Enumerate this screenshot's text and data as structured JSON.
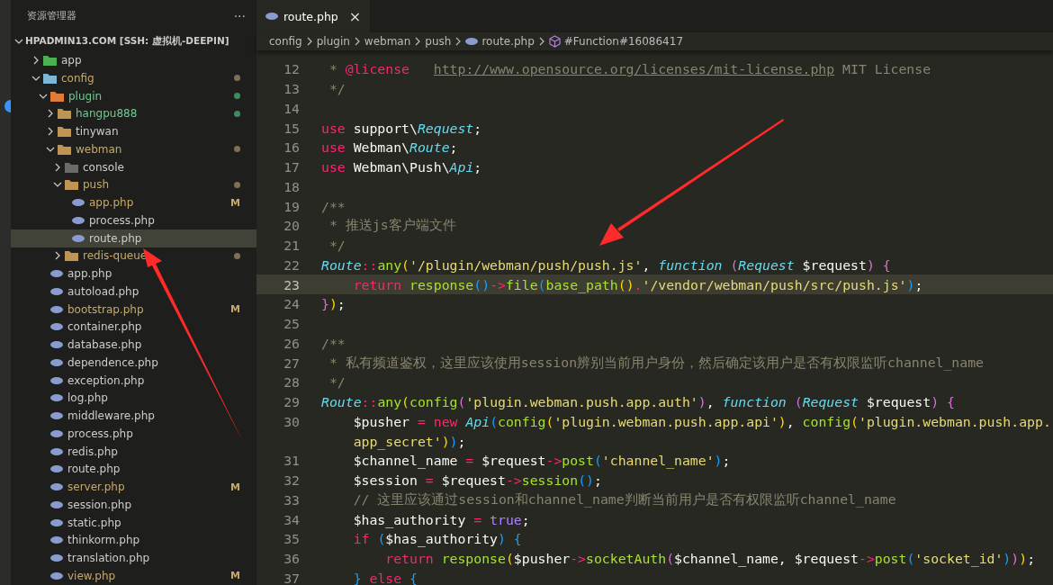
{
  "explorer": {
    "title": "资源管理器",
    "more": "···",
    "workspace": "HPADMIN13.COM [SSH: 虚拟机-DEEPIN]",
    "tree": [
      {
        "kind": "folder",
        "name": "app",
        "color": "#4caf50",
        "expanded": false,
        "modified": false,
        "untracked": false,
        "selected": false
      },
      {
        "kind": "folder",
        "name": "config",
        "color": "#7fb5d5",
        "expanded": true,
        "modified": true,
        "untracked": false,
        "selected": false,
        "children": [
          {
            "kind": "folder",
            "name": "plugin",
            "color": "#e07b39",
            "expanded": true,
            "modified": false,
            "untracked": true,
            "selected": false,
            "children": [
              {
                "kind": "folder",
                "name": "hangpu888",
                "color": "#c09553",
                "expanded": false,
                "modified": false,
                "untracked": true,
                "selected": false
              },
              {
                "kind": "folder",
                "name": "tinywan",
                "color": "#c09553",
                "expanded": false,
                "modified": false,
                "untracked": false,
                "selected": false
              },
              {
                "kind": "folder",
                "name": "webman",
                "color": "#c09553",
                "expanded": true,
                "modified": true,
                "untracked": false,
                "selected": false,
                "children": [
                  {
                    "kind": "folder",
                    "name": "console",
                    "color": "#6b6b6b",
                    "expanded": false,
                    "modified": false,
                    "untracked": false,
                    "selected": false
                  },
                  {
                    "kind": "folder",
                    "name": "push",
                    "color": "#c09553",
                    "expanded": true,
                    "modified": true,
                    "untracked": false,
                    "selected": false,
                    "children": [
                      {
                        "kind": "file",
                        "name": "app.php",
                        "modified": true,
                        "badge": "M",
                        "selected": false
                      },
                      {
                        "kind": "file",
                        "name": "process.php",
                        "modified": false,
                        "selected": false
                      },
                      {
                        "kind": "file",
                        "name": "route.php",
                        "modified": false,
                        "selected": true
                      }
                    ]
                  },
                  {
                    "kind": "folder",
                    "name": "redis-queue",
                    "color": "#c09553",
                    "expanded": false,
                    "modified": true,
                    "untracked": false,
                    "selected": false
                  }
                ]
              }
            ]
          },
          {
            "kind": "file",
            "name": "app.php",
            "modified": false,
            "selected": false
          },
          {
            "kind": "file",
            "name": "autoload.php",
            "modified": false,
            "selected": false
          },
          {
            "kind": "file",
            "name": "bootstrap.php",
            "modified": true,
            "badge": "M",
            "selected": false
          },
          {
            "kind": "file",
            "name": "container.php",
            "modified": false,
            "selected": false
          },
          {
            "kind": "file",
            "name": "database.php",
            "modified": false,
            "selected": false
          },
          {
            "kind": "file",
            "name": "dependence.php",
            "modified": false,
            "selected": false
          },
          {
            "kind": "file",
            "name": "exception.php",
            "modified": false,
            "selected": false
          },
          {
            "kind": "file",
            "name": "log.php",
            "modified": false,
            "selected": false
          },
          {
            "kind": "file",
            "name": "middleware.php",
            "modified": false,
            "selected": false
          },
          {
            "kind": "file",
            "name": "process.php",
            "modified": false,
            "selected": false
          },
          {
            "kind": "file",
            "name": "redis.php",
            "modified": false,
            "selected": false
          },
          {
            "kind": "file",
            "name": "route.php",
            "modified": false,
            "selected": false
          },
          {
            "kind": "file",
            "name": "server.php",
            "modified": true,
            "badge": "M",
            "selected": false
          },
          {
            "kind": "file",
            "name": "session.php",
            "modified": false,
            "selected": false
          },
          {
            "kind": "file",
            "name": "static.php",
            "modified": false,
            "selected": false
          },
          {
            "kind": "file",
            "name": "thinkorm.php",
            "modified": false,
            "selected": false
          },
          {
            "kind": "file",
            "name": "translation.php",
            "modified": false,
            "selected": false
          },
          {
            "kind": "file",
            "name": "view.php",
            "modified": true,
            "badge": "M",
            "selected": false
          }
        ]
      }
    ]
  },
  "tabs": [
    {
      "label": "route.php",
      "close": "×",
      "selected": true
    }
  ],
  "breadcrumbs": [
    {
      "kind": "folder",
      "label": "config"
    },
    {
      "kind": "folder",
      "label": "plugin"
    },
    {
      "kind": "folder",
      "label": "webman"
    },
    {
      "kind": "folder",
      "label": "push"
    },
    {
      "kind": "file",
      "label": "route.php"
    },
    {
      "kind": "symbol",
      "label": "#Function#16086417"
    }
  ],
  "code": [
    {
      "number": "12",
      "current": false,
      "text": " * @license   http://www.opensource.org/licenses/mit-license.php MIT License"
    },
    {
      "number": "13",
      "current": false,
      "text": " */"
    },
    {
      "number": "14",
      "current": false
    },
    {
      "number": "15",
      "current": false,
      "text": "use support\\Request;"
    },
    {
      "number": "16",
      "current": false,
      "text": "use Webman\\Route;"
    },
    {
      "number": "17",
      "current": false,
      "text": "use Webman\\Push\\Api;"
    },
    {
      "number": "18",
      "current": false
    },
    {
      "number": "19",
      "current": false,
      "text": "/**"
    },
    {
      "number": "20",
      "current": false,
      "text": " * 推送js客户端文件"
    },
    {
      "number": "21",
      "current": false,
      "text": " */"
    },
    {
      "number": "22",
      "current": false,
      "text": "Route::any('/plugin/webman/push/push.js', function (Request $request) {"
    },
    {
      "number": "23",
      "current": true,
      "text": "    return response()->file(base_path().'/vendor/webman/push/src/push.js');"
    },
    {
      "number": "24",
      "current": false,
      "text": "});"
    },
    {
      "number": "25",
      "current": false
    },
    {
      "number": "26",
      "current": false,
      "text": "/**"
    },
    {
      "number": "27",
      "current": false,
      "text": " * 私有频道鉴权，这里应该使用session辨别当前用户身份，然后确定该用户是否有权限监听channel_name"
    },
    {
      "number": "28",
      "current": false,
      "text": " */"
    },
    {
      "number": "29",
      "current": false,
      "text": "Route::any(config('plugin.webman.push.app.auth'), function (Request $request) {"
    },
    {
      "number": "30",
      "current": false,
      "text": "    $pusher = new Api(config('plugin.webman.push.app.api'), config('plugin.webman.push.app.",
      "wrapped": "    app_secret'));"
    },
    {
      "number": "31",
      "current": false,
      "text": "    $channel_name = $request->post('channel_name');"
    },
    {
      "number": "32",
      "current": false,
      "text": "    $session = $request->session();"
    },
    {
      "number": "33",
      "current": false,
      "text": "    // 这里应该通过session和channel_name判断当前用户是否有权限监听channel_name"
    },
    {
      "number": "34",
      "current": false,
      "text": "    $has_authority = true;"
    },
    {
      "number": "35",
      "current": false,
      "text": "    if ($has_authority) {"
    },
    {
      "number": "36",
      "current": false,
      "text": "        return response($pusher->socketAuth($channel_name, $request->post('socket_id')));"
    },
    {
      "number": "37",
      "current": false,
      "text": "    } else {"
    }
  ]
}
